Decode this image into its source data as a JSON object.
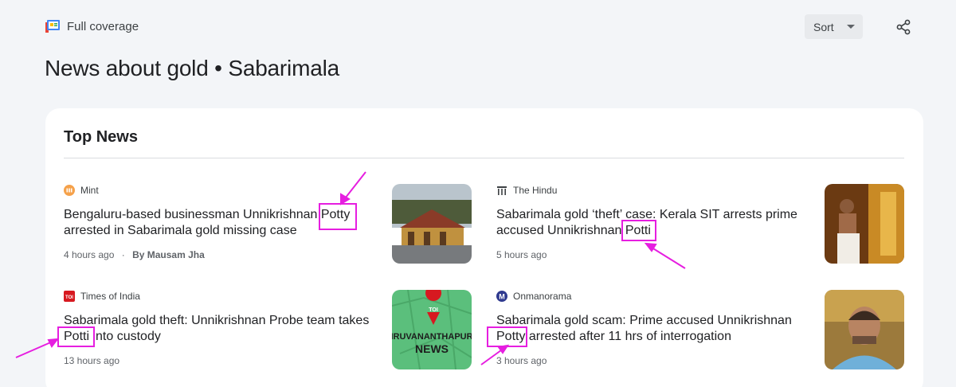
{
  "header": {
    "full_coverage_label": "Full coverage",
    "sort_label": "Sort",
    "page_title": "News about gold • Sabarimala"
  },
  "section": {
    "title": "Top News"
  },
  "articles": [
    {
      "source": "Mint",
      "headline": "Bengaluru-based businessman Unnikrishnan Potty arrested in Sabarimala gold missing case",
      "time": "4 hours ago",
      "separator": "·",
      "author": "By Mausam Jha",
      "logo_color": "#f5a14a",
      "thumb": "temple-building-photo"
    },
    {
      "source": "The Hindu",
      "headline": "Sabarimala gold ‘theft’ case: Kerala SIT arrests prime accused Unnikrishnan Potti",
      "time": "5 hours ago",
      "logo_color": "#3c4043",
      "thumb": "priest-ritual-photo"
    },
    {
      "source": "Times of India",
      "source_logo_text": "TOI",
      "headline": "Sabarimala gold theft: Unnikrishnan Probe team takes Potti into custody",
      "time": "13 hours ago",
      "logo_color": "#d71920",
      "thumb": "toi-thiruvananthapuram-news-graphic",
      "thumb_text": "IRUVANANTHAPUR",
      "thumb_text2": "NEWS",
      "thumb_pin": "TOI"
    },
    {
      "source": "Onmanorama",
      "source_logo_text": "M",
      "headline": "Sabarimala gold scam: Prime accused Unnikrishnan Potty arrested after 11 hrs of interrogation",
      "time": "3 hours ago",
      "logo_color": "#2f3a8f",
      "thumb": "man-portrait-photo"
    }
  ],
  "colors": {
    "annotation": "#e61ee0",
    "background": "#f3f5f8"
  }
}
